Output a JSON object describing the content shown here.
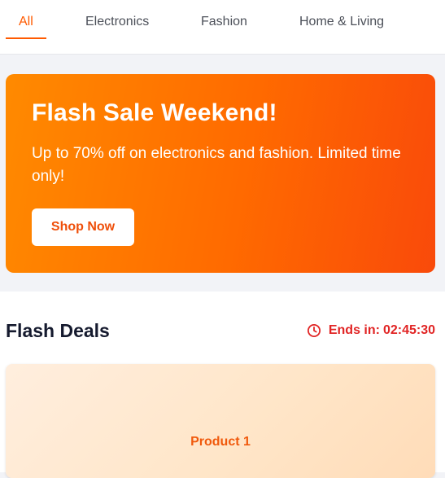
{
  "tabs": [
    {
      "label": "All",
      "active": true
    },
    {
      "label": "Electronics",
      "active": false
    },
    {
      "label": "Fashion",
      "active": false
    },
    {
      "label": "Home & Living",
      "active": false
    }
  ],
  "banner": {
    "title": "Flash Sale Weekend!",
    "text": "Up to 70% off on electronics and fashion. Limited time only!",
    "button_label": "Shop Now"
  },
  "deals": {
    "title": "Flash Deals",
    "timer_label": "Ends in:",
    "timer_value": "02:45:30",
    "timer_icon": "clock-icon"
  },
  "products": [
    {
      "name": "Product 1"
    }
  ],
  "colors": {
    "accent": "#ff5a00",
    "banner_start": "#ff8a00",
    "banner_end": "#f94a0a",
    "timer": "#e12424",
    "heading": "#151a2e"
  }
}
